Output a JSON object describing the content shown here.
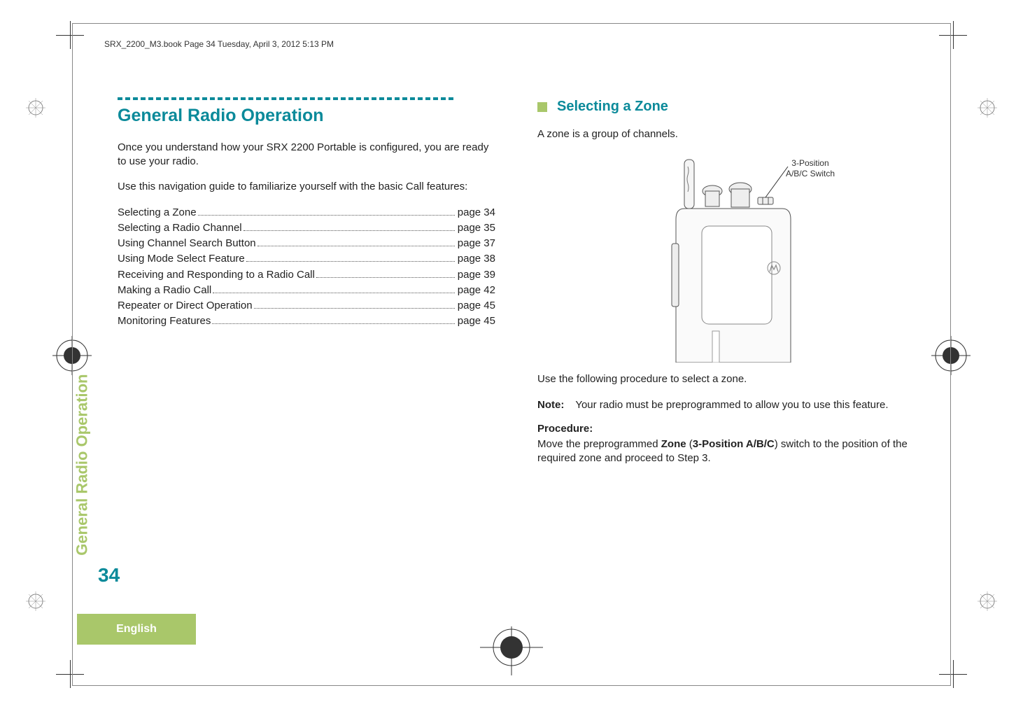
{
  "header": {
    "running_head": "SRX_2200_M3.book  Page 34  Tuesday, April 3, 2012  5:13 PM"
  },
  "side": {
    "vertical_label": "General Radio Operation",
    "page_number": "34",
    "language": "English"
  },
  "left_column": {
    "title": "General Radio Operation",
    "intro_1": "Once you understand how your SRX 2200 Portable is configured, you are ready to use your radio.",
    "intro_2": "Use this navigation guide to familiarize yourself with the basic Call features:",
    "toc": [
      {
        "label": "Selecting a Zone",
        "page": "page 34"
      },
      {
        "label": "Selecting a Radio Channel",
        "page": "page 35"
      },
      {
        "label": "Using Channel Search Button",
        "page": "page 37"
      },
      {
        "label": "Using Mode Select Feature",
        "page": "page 38"
      },
      {
        "label": "Receiving and Responding to a Radio Call",
        "page": "page 39"
      },
      {
        "label": "Making a Radio Call",
        "page": "page 42"
      },
      {
        "label": "Repeater or Direct Operation",
        "page": "page 45"
      },
      {
        "label": "Monitoring Features",
        "page": "page 45"
      }
    ]
  },
  "right_column": {
    "heading": "Selecting a Zone",
    "lead": "A zone is a group of channels.",
    "figure": {
      "callout_line1": "3-Position",
      "callout_line2": "A/B/C Switch"
    },
    "after_figure": "Use the following procedure to select a zone.",
    "note_label": "Note:",
    "note_text": "Your radio must be preprogrammed to allow you to use this feature.",
    "procedure_label": "Procedure:",
    "procedure_text_pre": "Move the preprogrammed ",
    "procedure_bold1": "Zone",
    "procedure_mid": " (",
    "procedure_bold2": "3-Position A/B/C",
    "procedure_text_post": ") switch to the position of the required zone and proceed to Step 3."
  }
}
